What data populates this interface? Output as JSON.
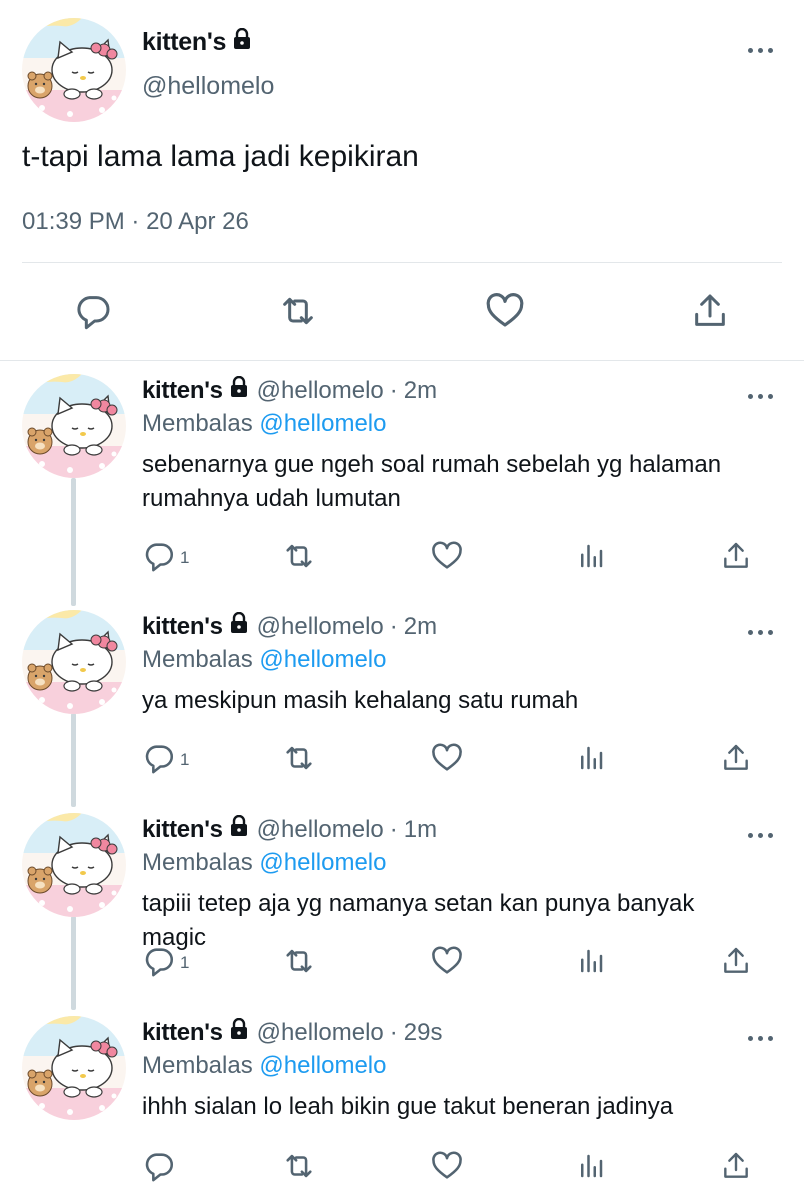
{
  "main_tweet": {
    "display_name": "kitten's",
    "handle": "@hellomelo",
    "text": "t-tapi lama lama jadi kepikiran",
    "time": "01:39 PM",
    "separator": "·",
    "date": "20 Apr 26"
  },
  "replies": [
    {
      "display_name": "kitten's",
      "handle": "@hellomelo",
      "separator": "·",
      "time": "2m",
      "replying_prefix": "Membalas",
      "replying_to": "@hellomelo",
      "text": "sebenarnya gue ngeh soal rumah sebelah yg halaman rumahnya udah lumutan",
      "reply_count": "1"
    },
    {
      "display_name": "kitten's",
      "handle": "@hellomelo",
      "separator": "·",
      "time": "2m",
      "replying_prefix": "Membalas",
      "replying_to": "@hellomelo",
      "text": "ya meskipun masih kehalang satu rumah",
      "reply_count": "1"
    },
    {
      "display_name": "kitten's",
      "handle": "@hellomelo",
      "separator": "·",
      "time": "1m",
      "replying_prefix": "Membalas",
      "replying_to": "@hellomelo",
      "text": "tapiii tetep aja yg namanya setan kan punya banyak magic",
      "reply_count": "1"
    },
    {
      "display_name": "kitten's",
      "handle": "@hellomelo",
      "separator": "·",
      "time": "29s",
      "replying_prefix": "Membalas",
      "replying_to": "@hellomelo",
      "text": "ihhh sialan lo leah bikin gue takut beneran jadinya",
      "reply_count": ""
    }
  ],
  "icons": {
    "reply": "reply-icon",
    "retweet": "retweet-icon",
    "like": "like-icon",
    "share": "share-icon",
    "analytics": "analytics-icon",
    "more": "more-icon",
    "lock": "lock-icon"
  },
  "colors": {
    "text": "#0f1419",
    "secondary": "#536471",
    "link": "#1d9bf0",
    "divider": "#e3e7ea",
    "thread_line": "#cfd9de"
  }
}
